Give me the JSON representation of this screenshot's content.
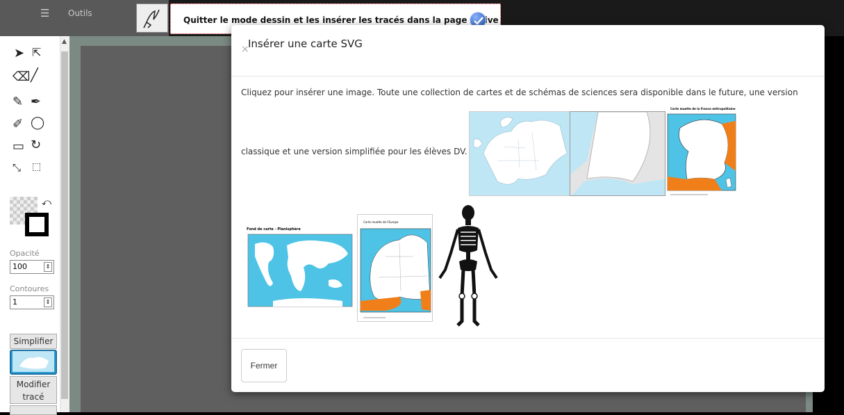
{
  "header": {
    "menu_icon": "menu-icon",
    "tools_label": "Outils",
    "banner_text": "Quitter le mode dessin et les insérer les tracés dans la page active"
  },
  "sidebar": {
    "opacity_label": "Opacité",
    "opacity_value": "100",
    "contours_label": "Contoures",
    "contours_value": "1",
    "simplify_label": "Simplifier",
    "modify_label_1": "Modifier",
    "modify_label_2": "tracé"
  },
  "modal": {
    "title": "Insérer une carte SVG",
    "close_glyph": "×",
    "description_line1": "Cliquez pour insérer une image. Toute une collection de cartes et de schémas de sciences sera disponible dans le future, une version",
    "description_line2": "classique et une version simplifiée pour les élèves DV.",
    "france_caption": "Carte muette de la France métropolitaine",
    "world_caption": "Fond de carte - Planisphère",
    "europe_caption": "Carte muette de l'Europe",
    "close_button": "Fermer"
  },
  "colors": {
    "map_blue": "#4fc3e6",
    "map_orange": "#f07f1a"
  }
}
